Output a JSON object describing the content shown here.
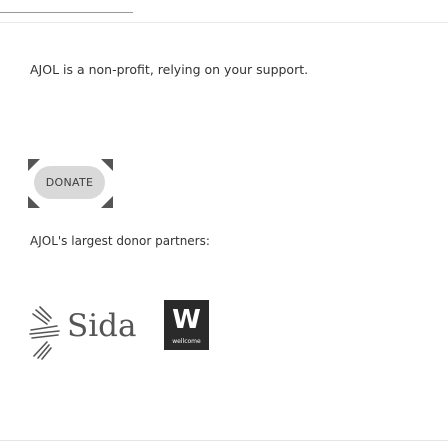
{
  "support": {
    "text": "AJOL is a non-profit, relying on your support."
  },
  "donate": {
    "label": "DONATE"
  },
  "partners": {
    "heading": "AJOL's largest donor partners:",
    "logos": [
      {
        "name": "Sida",
        "text": "Sida",
        "icon": "sida-crown-mark"
      },
      {
        "name": "Wellcome",
        "text": "W",
        "caption": "wellcome"
      }
    ]
  },
  "colors": {
    "button_bg": "#d9d9d9",
    "button_corner": "#555555",
    "text": "#333333",
    "wellcome_bg": "#2a2a2a"
  }
}
